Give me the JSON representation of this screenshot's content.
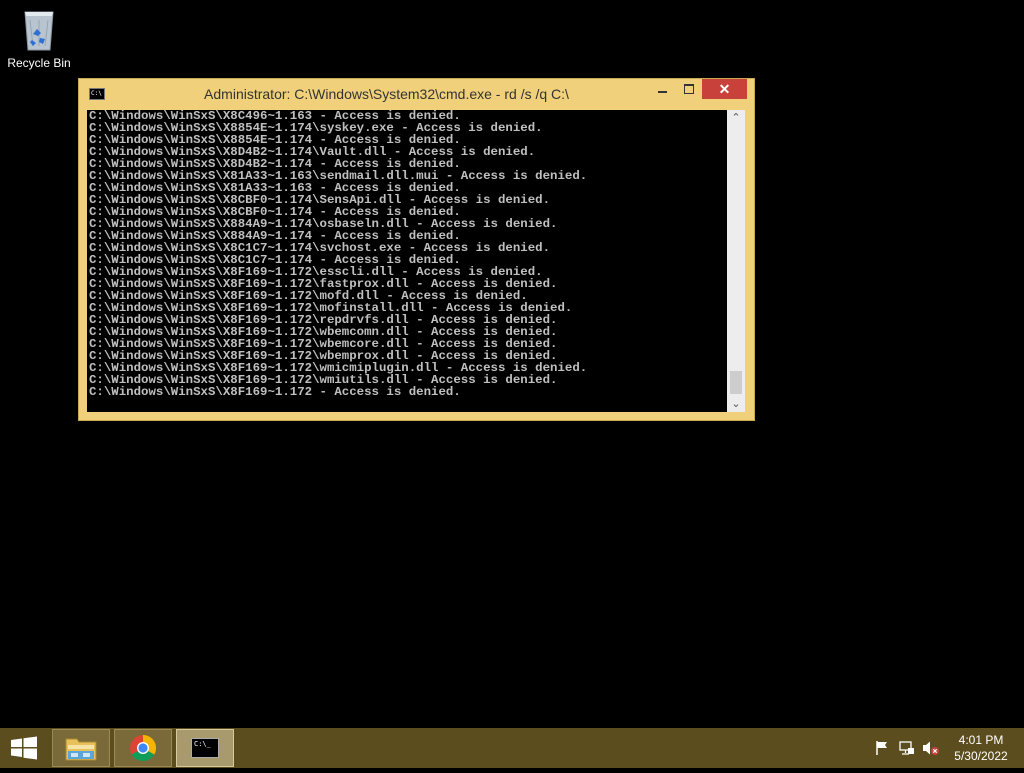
{
  "desktop": {
    "recycle_bin_label": "Recycle Bin"
  },
  "window": {
    "title": "Administrator: C:\\Windows\\System32\\cmd.exe - rd  /s /q C:\\",
    "icon_text": "C:\\",
    "minimize_glyph": "—",
    "maximize_glyph": "□",
    "close_glyph": "✕"
  },
  "console": {
    "lines": [
      "C:\\Windows\\WinSxS\\X8C496~1.163 - Access is denied.",
      "C:\\Windows\\WinSxS\\X8854E~1.174\\syskey.exe - Access is denied.",
      "C:\\Windows\\WinSxS\\X8854E~1.174 - Access is denied.",
      "C:\\Windows\\WinSxS\\X8D4B2~1.174\\Vault.dll - Access is denied.",
      "C:\\Windows\\WinSxS\\X8D4B2~1.174 - Access is denied.",
      "C:\\Windows\\WinSxS\\X81A33~1.163\\sendmail.dll.mui - Access is denied.",
      "C:\\Windows\\WinSxS\\X81A33~1.163 - Access is denied.",
      "C:\\Windows\\WinSxS\\X8CBF0~1.174\\SensApi.dll - Access is denied.",
      "C:\\Windows\\WinSxS\\X8CBF0~1.174 - Access is denied.",
      "C:\\Windows\\WinSxS\\X884A9~1.174\\osbaseln.dll - Access is denied.",
      "C:\\Windows\\WinSxS\\X884A9~1.174 - Access is denied.",
      "C:\\Windows\\WinSxS\\X8C1C7~1.174\\svchost.exe - Access is denied.",
      "C:\\Windows\\WinSxS\\X8C1C7~1.174 - Access is denied.",
      "C:\\Windows\\WinSxS\\X8F169~1.172\\esscli.dll - Access is denied.",
      "C:\\Windows\\WinSxS\\X8F169~1.172\\fastprox.dll - Access is denied.",
      "C:\\Windows\\WinSxS\\X8F169~1.172\\mofd.dll - Access is denied.",
      "C:\\Windows\\WinSxS\\X8F169~1.172\\mofinstall.dll - Access is denied.",
      "C:\\Windows\\WinSxS\\X8F169~1.172\\repdrvfs.dll - Access is denied.",
      "C:\\Windows\\WinSxS\\X8F169~1.172\\wbemcomn.dll - Access is denied.",
      "C:\\Windows\\WinSxS\\X8F169~1.172\\wbemcore.dll - Access is denied.",
      "C:\\Windows\\WinSxS\\X8F169~1.172\\wbemprox.dll - Access is denied.",
      "C:\\Windows\\WinSxS\\X8F169~1.172\\wmicmiplugin.dll - Access is denied.",
      "C:\\Windows\\WinSxS\\X8F169~1.172\\wmiutils.dll - Access is denied.",
      "C:\\Windows\\WinSxS\\X8F169~1.172 - Access is denied."
    ]
  },
  "scrollbar": {
    "up_glyph": "⌃",
    "down_glyph": "⌄"
  },
  "taskbar": {
    "apps": [
      "file-explorer",
      "chrome",
      "command-prompt"
    ],
    "cmd_icon_text": "C:\\_",
    "time": "4:01 PM",
    "date": "5/30/2022",
    "accent_color": "#5c4d1f"
  },
  "colors": {
    "window_frame": "#f0d07a",
    "close_button": "#c8413a",
    "console_bg": "#000000",
    "console_text": "#c0c0c0"
  }
}
